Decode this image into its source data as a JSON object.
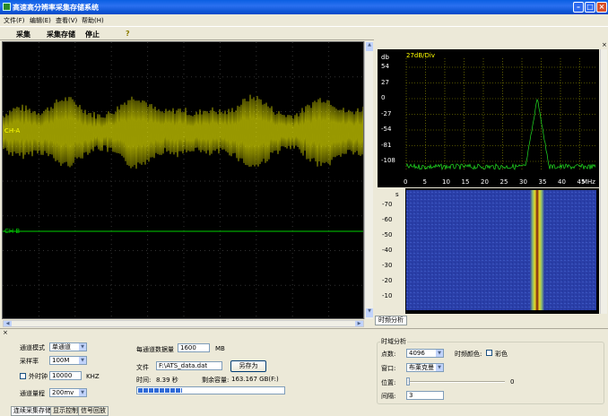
{
  "window": {
    "title": "高速高分辨率采集存储系统"
  },
  "menu": [
    "文件(F)",
    "编辑(E)",
    "查看(V)",
    "帮助(H)"
  ],
  "toolbar": {
    "acquire": "采集",
    "acquire_store": "采集存储",
    "stop": "停止",
    "help_glyph": "?"
  },
  "scope": {
    "ch_a": "CH-A",
    "ch_b": "CH-B"
  },
  "spectrum": {
    "unit_label": "db",
    "scale_label": "27dB/Div",
    "y_ticks": [
      "54",
      "27",
      "0",
      "-27",
      "-54",
      "-81",
      "-108"
    ],
    "x_ticks": [
      "0",
      "5",
      "10",
      "15",
      "20",
      "25",
      "30",
      "35",
      "40",
      "45"
    ],
    "x_unit": "MHz"
  },
  "waterfall": {
    "unit_label": "s",
    "y_ticks": [
      "-70",
      "-60",
      "-50",
      "-40",
      "-30",
      "-20",
      "-10"
    ]
  },
  "right_tab": "时频分析",
  "controls": {
    "channel_mode_label": "通道模式",
    "channel_mode_value": "单通道",
    "sample_rate_label": "采样率",
    "sample_rate_value": "100M",
    "ext_clock_label": "外时钟",
    "ext_clock_value": "10000",
    "ext_clock_unit": "KHZ",
    "range_label": "通道量程",
    "range_value": "200mv",
    "data_per_channel_label": "每通道数据量",
    "data_per_channel_value": "1600",
    "data_unit": "MB",
    "file_label": "文件",
    "file_value": "F:\\ATS_data.dat",
    "save_as": "另存为",
    "time_label": "时间:",
    "time_value": "8.39 秒",
    "remaining_label": "剩余容量:",
    "remaining_value": "163.167 GB(F:)",
    "progress": 0.3
  },
  "tf_analysis": {
    "group_title": "时域分析",
    "points_label": "点数:",
    "points_value": "4096",
    "tf_color_label": "时频颜色:",
    "color_label": "彩色",
    "window_label": "窗口:",
    "window_value": "布莱克曼",
    "position_label": "位置:",
    "position_value": "0",
    "interval_label": "间隔:",
    "interval_value": "3"
  },
  "bottom_tabs": [
    "连续采集存储",
    "显示控制",
    "信号回放"
  ],
  "colors": {
    "waveform_a": "#FFFF00",
    "waveform_b": "#00D000",
    "spectrum": "#22E022",
    "spectrum_text": "#FFFF00",
    "waterfall_bg": "#2B3FA8"
  }
}
